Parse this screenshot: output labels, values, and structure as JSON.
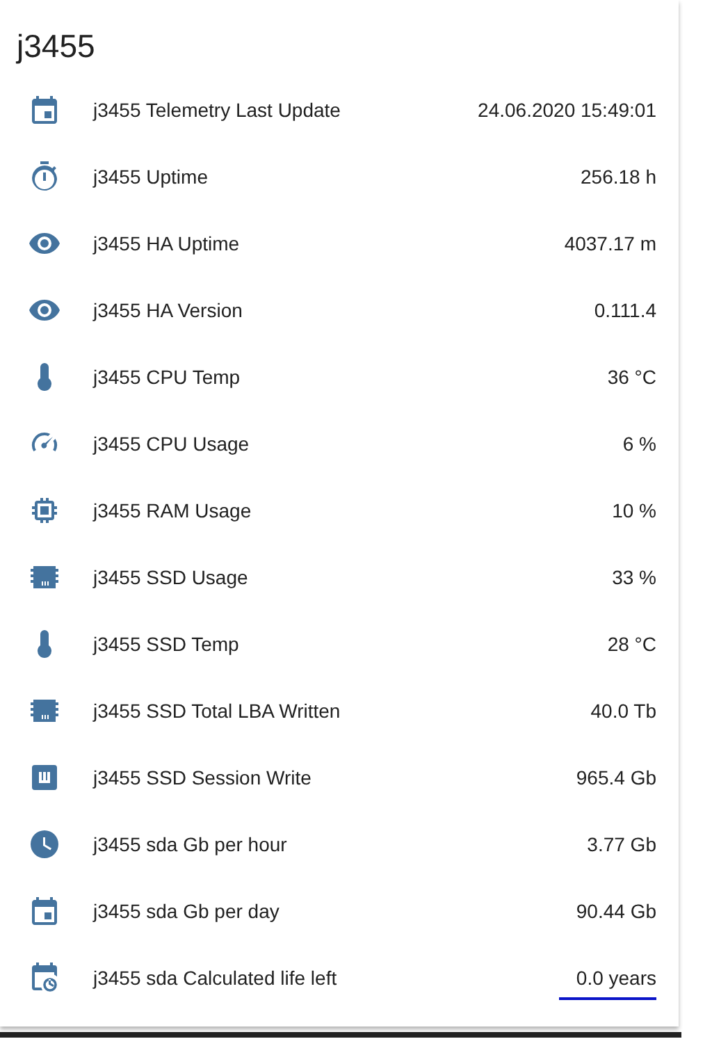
{
  "card": {
    "title": "j3455",
    "rows": [
      {
        "name": "j3455 Telemetry Last Update",
        "value": "24.06.2020 15:49:01"
      },
      {
        "name": "j3455 Uptime",
        "value": "256.18 h"
      },
      {
        "name": "j3455 HA Uptime",
        "value": "4037.17 m"
      },
      {
        "name": "j3455 HA Version",
        "value": "0.111.4"
      },
      {
        "name": "j3455 CPU Temp",
        "value": "36 °C"
      },
      {
        "name": "j3455 CPU Usage",
        "value": "6 %"
      },
      {
        "name": "j3455 RAM Usage",
        "value": "10 %"
      },
      {
        "name": "j3455 SSD Usage",
        "value": "33 %"
      },
      {
        "name": "j3455 SSD Temp",
        "value": "28 °C"
      },
      {
        "name": "j3455 SSD Total LBA Written",
        "value": "40.0 Tb"
      },
      {
        "name": "j3455 SSD Session Write",
        "value": "965.4 Gb"
      },
      {
        "name": "j3455 sda Gb per hour",
        "value": "3.77 Gb"
      },
      {
        "name": "j3455 sda Gb per day",
        "value": "90.44 Gb"
      },
      {
        "name": "j3455 sda Calculated life left",
        "value": "0.0 years",
        "underlined": true
      }
    ]
  }
}
